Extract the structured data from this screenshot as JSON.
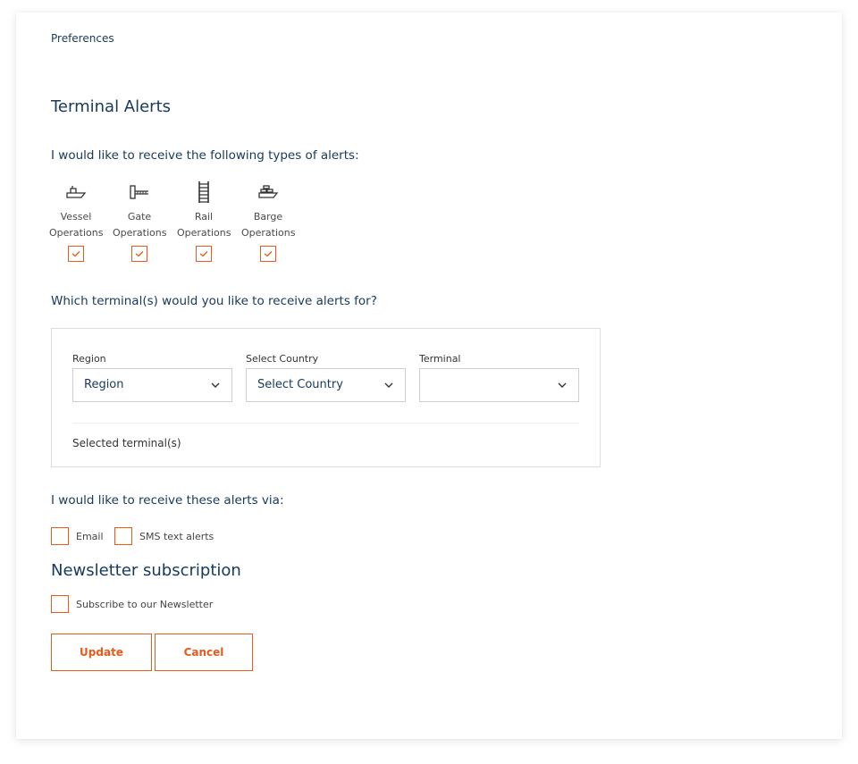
{
  "breadcrumb": "Preferences",
  "terminal_alerts": {
    "title": "Terminal Alerts",
    "types_question": "I would like to receive the following types of alerts:",
    "types": [
      {
        "icon": "vessel-icon",
        "line1": "Vessel",
        "line2": "Operations",
        "checked": true
      },
      {
        "icon": "gate-icon",
        "line1": "Gate",
        "line2": "Operations",
        "checked": true
      },
      {
        "icon": "rail-icon",
        "line1": "Rail",
        "line2": "Operations",
        "checked": true
      },
      {
        "icon": "barge-icon",
        "line1": "Barge",
        "line2": "Operations",
        "checked": true
      }
    ],
    "terminals_question": "Which terminal(s) would you like to receive alerts for?",
    "region": {
      "label": "Region",
      "value": "Region"
    },
    "country": {
      "label": "Select Country",
      "value": "Select Country"
    },
    "terminal": {
      "label": "Terminal",
      "value": ""
    },
    "selected_terminals_label": "Selected terminal(s)",
    "via_question": "I would like to receive these alerts via:",
    "via": [
      {
        "label": "Email",
        "checked": false
      },
      {
        "label": "SMS text alerts",
        "checked": false
      }
    ]
  },
  "newsletter": {
    "title": "Newsletter subscription",
    "subscribe_label": "Subscribe to our Newsletter",
    "checked": false
  },
  "actions": {
    "update_label": "Update",
    "cancel_label": "Cancel"
  },
  "colors": {
    "accent": "#e8591a",
    "heading": "#163a5c"
  }
}
